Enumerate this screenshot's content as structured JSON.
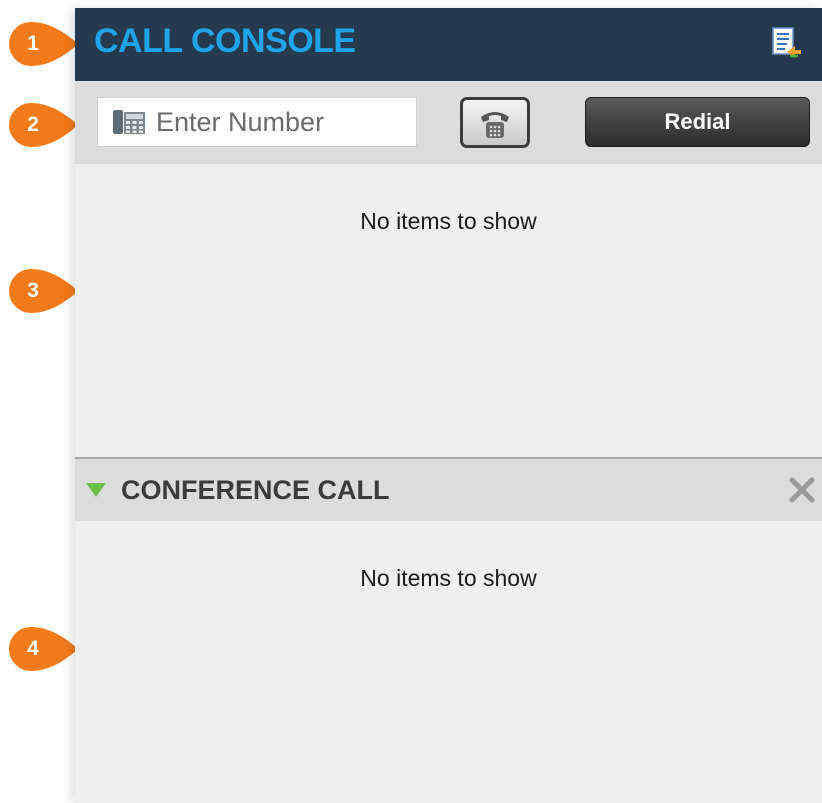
{
  "header": {
    "title": "CALL CONSOLE",
    "icon": "call-log-icon"
  },
  "dialer": {
    "placeholder": "Enter Number",
    "value": "",
    "field_icon": "desk-phone-icon",
    "dial_icon": "phone-handset-icon",
    "redial_label": "Redial"
  },
  "calls": {
    "empty_message": "No items to show"
  },
  "conference": {
    "title": "CONFERENCE CALL",
    "toggle_icon": "triangle-down-icon",
    "close_icon": "close-icon",
    "empty_message": "No items to show"
  },
  "callouts": [
    {
      "label": "1"
    },
    {
      "label": "2"
    },
    {
      "label": "3"
    },
    {
      "label": "4"
    }
  ],
  "colors": {
    "header_bg": "#253a4f",
    "title_blue": "#1ea4e9",
    "callout_orange": "#f47a1a",
    "toggle_green": "#6cc04a"
  }
}
